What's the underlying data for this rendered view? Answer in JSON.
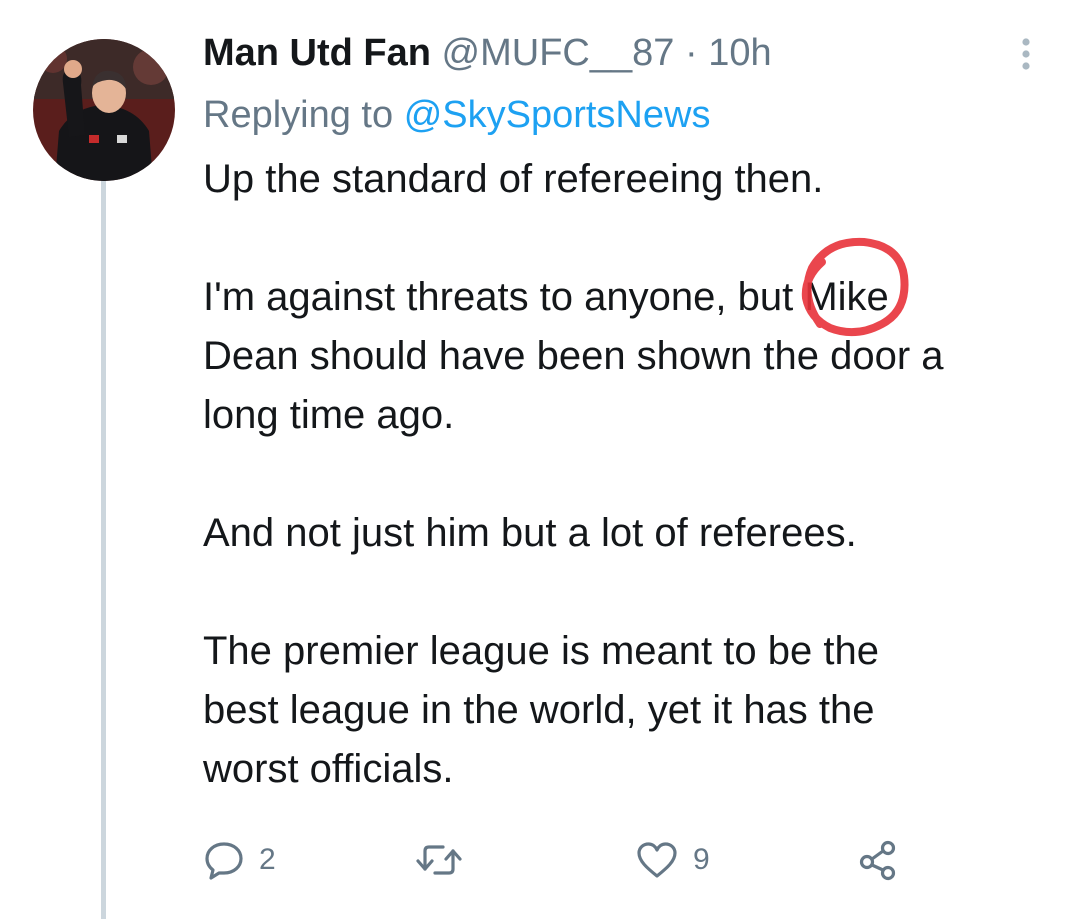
{
  "tweet": {
    "display_name": "Man Utd Fan",
    "handle": "@MUFC__87",
    "separator": "·",
    "timestamp": "10h",
    "replying_to_prefix": "Replying to",
    "replying_to_handle": "@SkySportsNews",
    "paragraphs": [
      "Up the standard of refereeing then.",
      "I'm against threats to anyone, but Mike\nDean should have been shown the door a\nlong time ago.",
      "And not just him but a lot of referees.",
      "The premier league is meant to be the\nbest league in the world, yet it has the\nworst officials."
    ],
    "actions": {
      "reply_count": "2",
      "retweet_count": "",
      "like_count": "9"
    }
  },
  "icons": {
    "more": "more-vertical-icon",
    "reply": "comment-bubble-icon",
    "retweet": "retweet-arrows-icon",
    "like": "heart-icon",
    "share": "share-icon"
  },
  "colors": {
    "text_primary": "#14171a",
    "text_secondary": "#657786",
    "link": "#1da1f2",
    "thread_line": "#ccd6dd",
    "annotation_circle": "#e8323a"
  }
}
